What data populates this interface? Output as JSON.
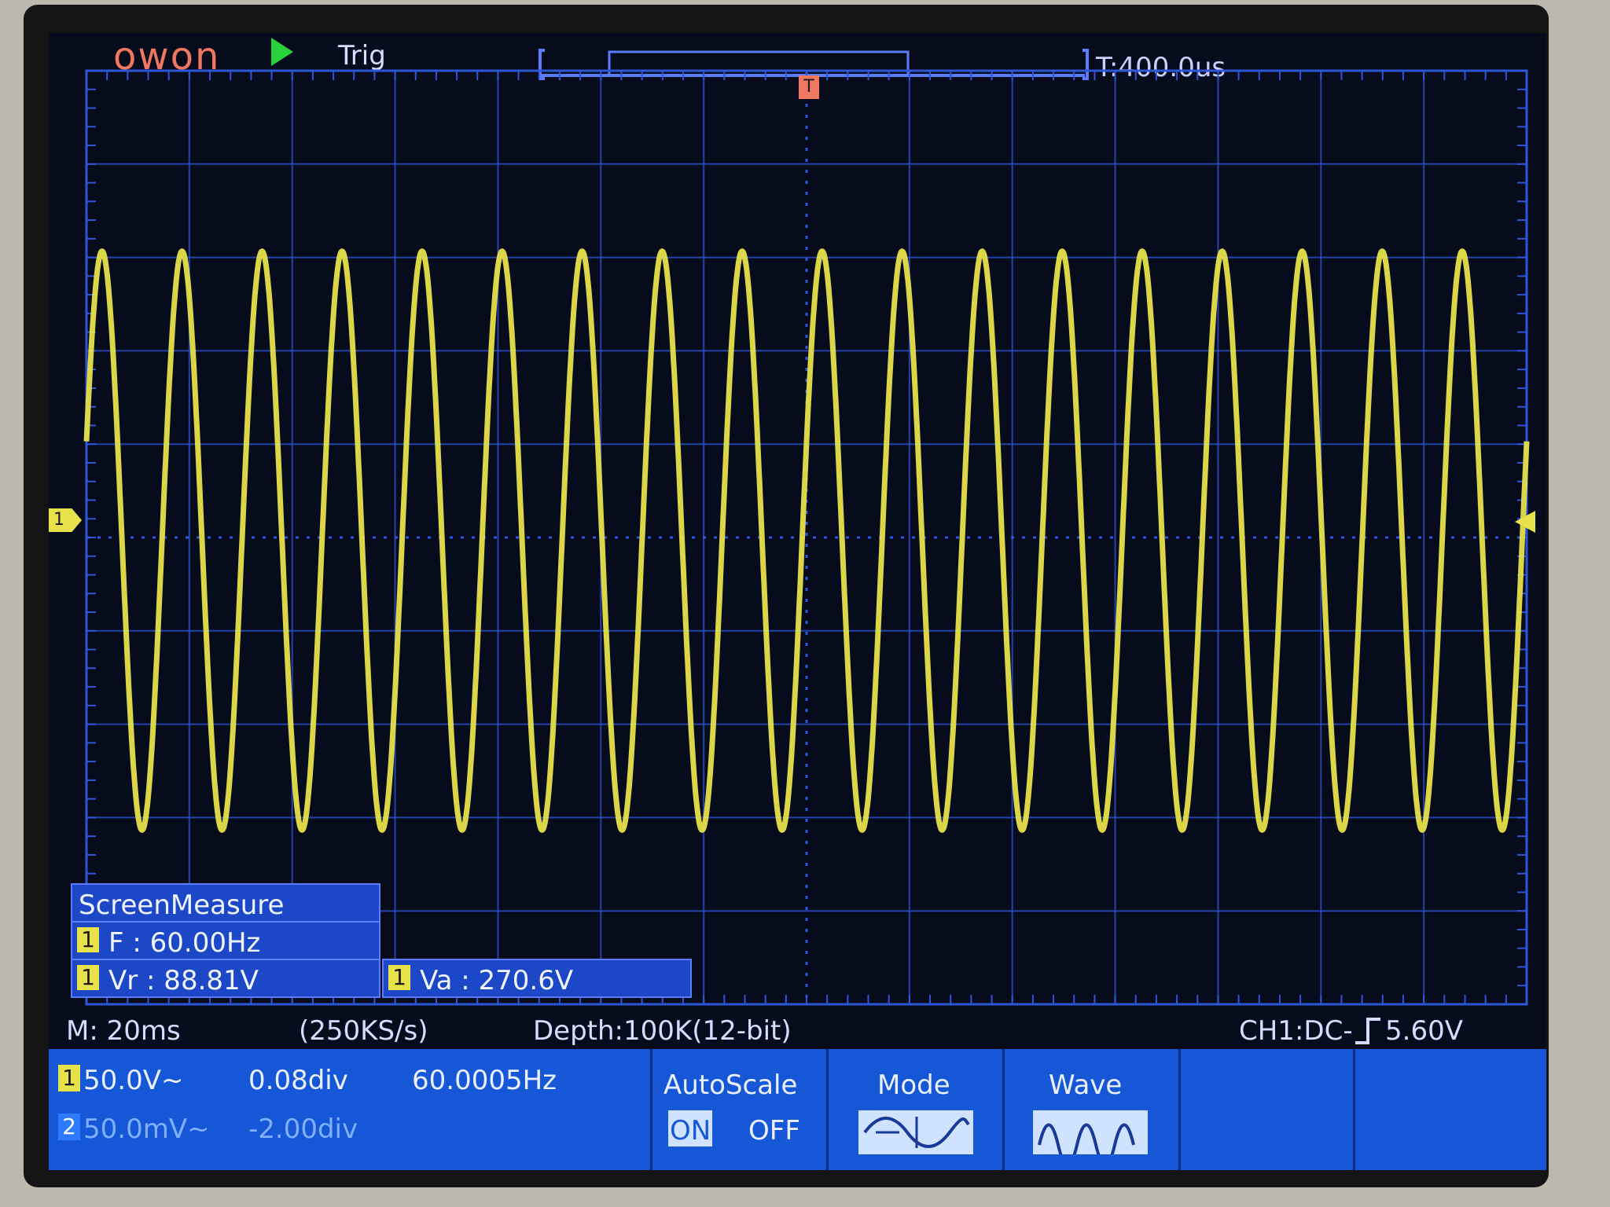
{
  "header": {
    "brand": "owon",
    "run_state": "Trig",
    "time_position": "T:400.0us"
  },
  "measure": {
    "title": "ScreenMeasure",
    "rows": [
      {
        "ch": "1",
        "label": "F : 60.00Hz"
      },
      {
        "ch": "1",
        "label": "Vr : 88.81V"
      },
      {
        "ch": "1",
        "label": "Va : 270.6V"
      }
    ]
  },
  "status": {
    "timebase": "M: 20ms",
    "sample_rate": "(250KS/s)",
    "depth": "Depth:100K(12-bit)",
    "trigger": "CH1:DC-",
    "trigger_level": "5.60V"
  },
  "channels": [
    {
      "id": "1",
      "scale": "50.0V~",
      "offset": "0.08div",
      "freq": "60.0005Hz",
      "color": "#e7e24a"
    },
    {
      "id": "2",
      "scale": "50.0mV~",
      "offset": "-2.00div",
      "color": "#2d7cff"
    }
  ],
  "menu": {
    "autoscale": "AutoScale",
    "on": "ON",
    "off": "OFF",
    "mode": "Mode",
    "wave": "Wave"
  },
  "markers": {
    "ch1": "1",
    "trigger_marker": "T"
  },
  "chart_data": {
    "type": "line",
    "series": [
      {
        "name": "1",
        "frequency_hz": 60.0,
        "waveform": "sine",
        "cycles_on_screen": 18
      }
    ],
    "timebase_per_div_ms": 20,
    "volts_per_div": 50,
    "grid": true
  },
  "colors": {
    "trace": "#e7e24a",
    "grid": "#2f55d8",
    "screen_bg": "#070c1c",
    "menu_bg": "#1557d6"
  }
}
